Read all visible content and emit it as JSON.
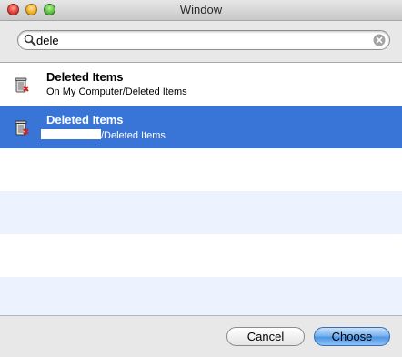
{
  "window": {
    "title": "Window"
  },
  "search": {
    "value": "dele",
    "placeholder": ""
  },
  "results": [
    {
      "name": "Deleted Items",
      "path": "On My Computer/Deleted Items",
      "icon": "trash-icon",
      "selected": false
    },
    {
      "name": "Deleted Items",
      "path": "/Deleted Items",
      "icon": "trash-icon",
      "selected": true
    }
  ],
  "buttons": {
    "cancel": "Cancel",
    "choose": "Choose"
  },
  "colors": {
    "selection": "#3875d7",
    "alternate_row": "#edf3fe"
  }
}
